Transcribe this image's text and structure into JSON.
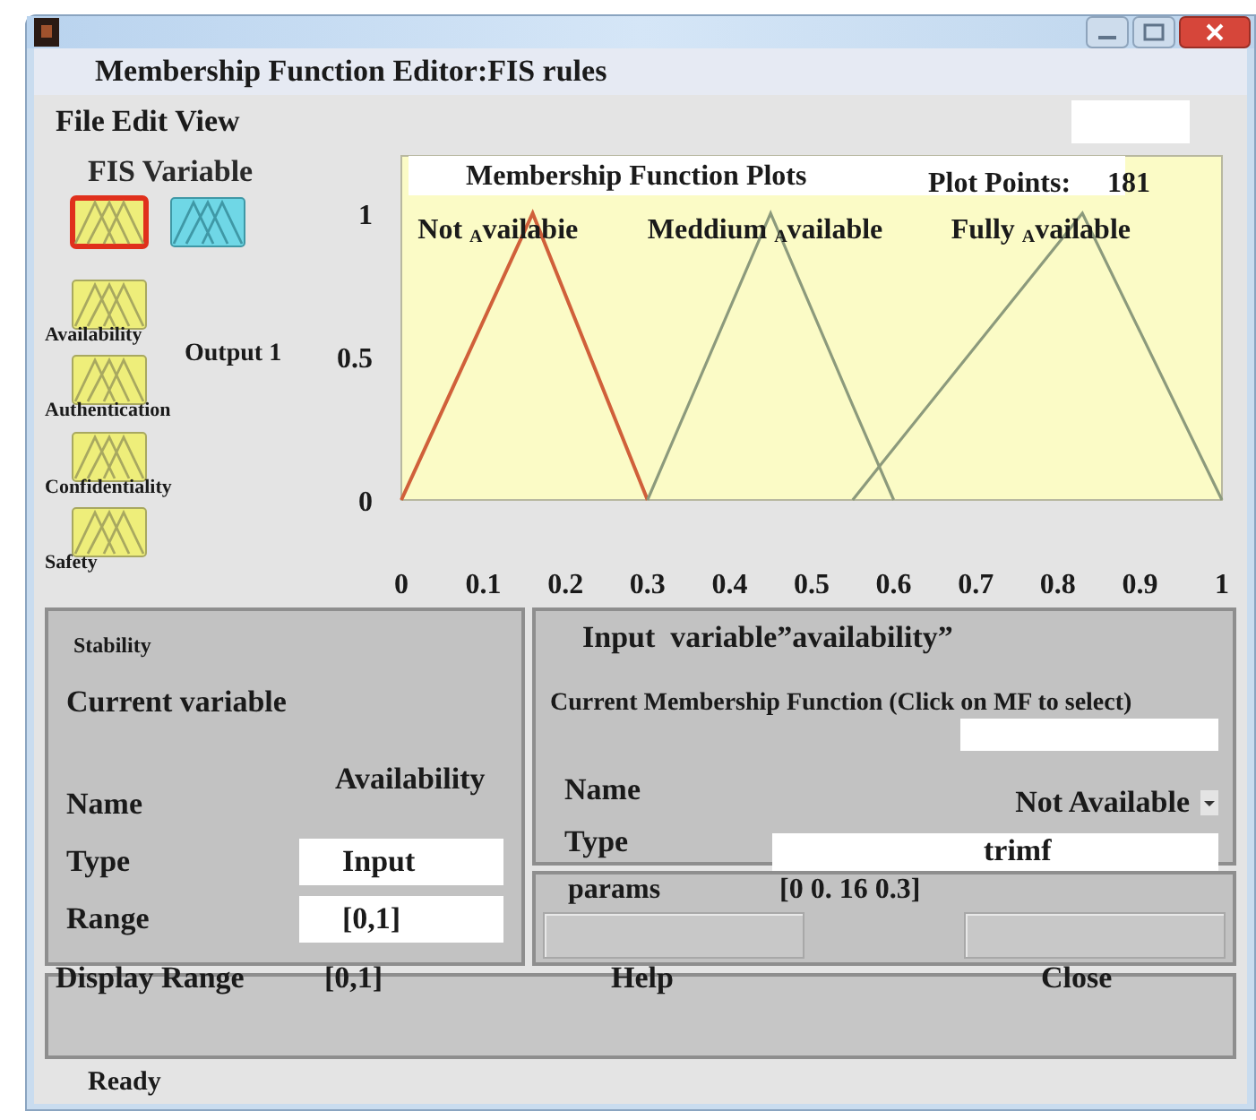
{
  "window": {
    "title": "Membership Function Editor:FIS rules"
  },
  "menu": [
    "File",
    "Edit",
    "View"
  ],
  "fis_panel": {
    "label": "FIS Variable",
    "variables": [
      {
        "kind": "input",
        "selected": true
      },
      {
        "kind": "output",
        "selected": false
      },
      {
        "kind": "input",
        "label": "Availability",
        "selected": false
      },
      {
        "kind": "input",
        "label": "Authentication",
        "selected": false
      },
      {
        "kind": "input",
        "label": "Confidentiality",
        "selected": false
      },
      {
        "kind": "input",
        "label": "Safety",
        "selected": false
      }
    ],
    "output_label": "Output 1"
  },
  "plot": {
    "title": "Membership Function Plots",
    "plot_points_label": "Plot Points:",
    "plot_points": "181",
    "mf_labels": [
      "Not $_{A}$vailabie",
      "Meddium $_{A}$vailable",
      "Fully $_{A}$vailable"
    ],
    "chart_data": {
      "type": "line",
      "x": [
        0,
        0.16,
        0.3,
        0.45,
        0.55,
        0.6,
        0.83,
        1
      ],
      "series": [
        {
          "color": "#d0603a",
          "values": [
            0,
            1,
            0,
            null,
            null,
            null,
            null,
            null
          ]
        },
        {
          "color": "#8c9a7c",
          "values": [
            null,
            null,
            0,
            1,
            0.33,
            0,
            null,
            null
          ]
        },
        {
          "color": "#8c9a7c",
          "values": [
            null,
            null,
            null,
            null,
            0,
            0.18,
            1,
            0
          ]
        }
      ],
      "xlim": [
        0,
        1
      ],
      "ylim": [
        0,
        1.2
      ],
      "xticks": [
        0,
        0.1,
        0.2,
        0.3,
        0.4,
        0.5,
        0.6,
        0.7,
        0.8,
        0.9,
        1
      ],
      "yticks": [
        0,
        0.5,
        1
      ]
    }
  },
  "current_variable": {
    "caption": "Stability",
    "title": "Current variable",
    "name_label": "Name",
    "name": "Availability",
    "type_label": "Type",
    "type": "Input",
    "range_label": "Range",
    "range": "[0,1]"
  },
  "mf_panel": {
    "title": "Input  variable”availability”",
    "subtitle": "Current Membership Function (Click on MF to select)",
    "name_label": "Name",
    "name": "Not Available",
    "type_label": "Type",
    "type": "trimf",
    "params_label": "params",
    "params": "[0 0. 16 0.3]"
  },
  "bottom": {
    "display_range_label": "Display Range",
    "display_range": "[0,1]",
    "help": "Help",
    "close": "Close"
  },
  "status_bar": "Ready"
}
